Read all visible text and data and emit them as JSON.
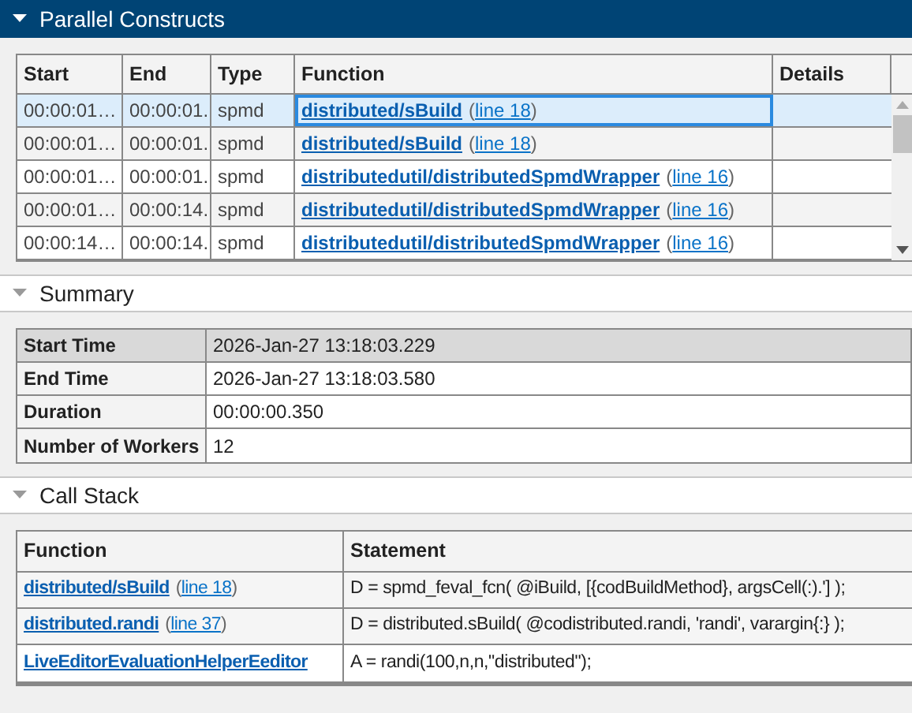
{
  "parallel_constructs": {
    "header": {
      "title": "Parallel Constructs",
      "selected": true
    },
    "columns": [
      "Start",
      "End",
      "Type",
      "Function",
      "Details"
    ],
    "rows": [
      {
        "start": "00:00:01…",
        "end": "00:00:01.",
        "type": "spmd",
        "function": "distributed/sBuild",
        "open": "(",
        "line": "line 18",
        "close": ")",
        "selected": true
      },
      {
        "start": "00:00:01…",
        "end": "00:00:01.",
        "type": "spmd",
        "function": "distributed/sBuild",
        "open": "(",
        "line": "line 18",
        "close": ")",
        "selected": false
      },
      {
        "start": "00:00:01…",
        "end": "00:00:01.",
        "type": "spmd",
        "function": "distributedutil/distributedSpmdWrapper",
        "open": "(",
        "line": "line 16",
        "close": ")",
        "selected": false
      },
      {
        "start": "00:00:01…",
        "end": "00:00:14.",
        "type": "spmd",
        "function": "distributedutil/distributedSpmdWrapper",
        "open": "(",
        "line": "line 16",
        "close": ")",
        "selected": false
      },
      {
        "start": "00:00:14…",
        "end": "00:00:14.",
        "type": "spmd",
        "function": "distributedutil/distributedSpmdWrapper",
        "open": "(",
        "line": "line 16",
        "close": ")",
        "selected": false
      }
    ]
  },
  "summary": {
    "header": {
      "title": "Summary",
      "selected": false
    },
    "rows": [
      {
        "label": "Start Time",
        "value": "2026-Jan-27 13:18:03.229",
        "selected": true
      },
      {
        "label": "End Time",
        "value": "2026-Jan-27 13:18:03.580",
        "selected": false
      },
      {
        "label": "Duration",
        "value": "00:00:00.350",
        "selected": false
      },
      {
        "label": "Number of Workers",
        "value": "12",
        "selected": false
      }
    ]
  },
  "call_stack": {
    "header": {
      "title": "Call Stack",
      "selected": false
    },
    "columns": [
      "Function",
      "Statement"
    ],
    "rows": [
      {
        "function": "distributed/sBuild",
        "open": "(",
        "line": "line 18",
        "close": ")",
        "statement": "D = spmd_feval_fcn( @iBuild, [{codBuildMethod}, argsCell(:).'] );"
      },
      {
        "function": "distributed.randi",
        "open": "(",
        "line": "line 37",
        "close": ")",
        "statement": "D = distributed.sBuild( @codistributed.randi, 'randi', varargin{:} );"
      },
      {
        "function": "LiveEditorEvaluationHelperEeditor",
        "statement": "A = randi(100,n,n,\"distributed\");"
      }
    ]
  }
}
